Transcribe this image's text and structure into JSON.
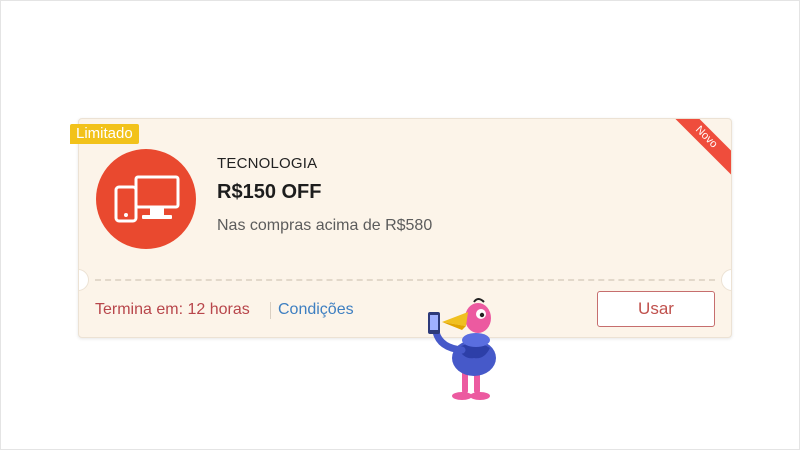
{
  "coupon": {
    "badge_limited": "Limitado",
    "ribbon_new": "Novo",
    "category": "TECNOLOGIA",
    "discount": "R$150 OFF",
    "condition": "Nas compras acima de R$580",
    "icon": "devices-icon",
    "expires": "Termina em: 12 horas",
    "conditions_link": "Condições",
    "use_button": "Usar"
  },
  "mascot": {
    "icon": "bird-mascot-with-phone"
  },
  "colors": {
    "coupon_bg": "#fcf4e9",
    "icon_circle": "#e9492f",
    "badge_limited": "#f2c21a",
    "ribbon_new": "#ef4d3c",
    "expires_text": "#b8464b",
    "link": "#3e7fc1",
    "button_text": "#c0514d"
  }
}
